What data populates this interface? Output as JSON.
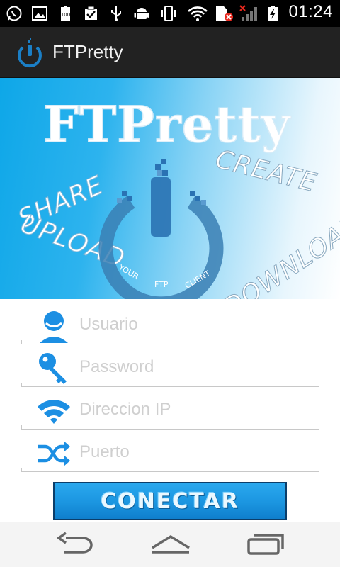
{
  "status_bar": {
    "time": "01:24",
    "icons": [
      "whatsapp-icon",
      "image-icon",
      "battery-100-icon",
      "task-icon",
      "usb-icon",
      "android-icon",
      "phone-vibrate-icon",
      "wifi-icon",
      "sim-error-icon",
      "signal-off-icon",
      "battery-charging-icon"
    ],
    "battery_badge": "100"
  },
  "action_bar": {
    "title": "FTPretty"
  },
  "banner": {
    "logo_title": "FTPretty",
    "word_share": "SHARE",
    "word_upload": "UPLOAD",
    "word_create": "CREATE",
    "word_download": "DOWNLOAD",
    "ring_word_1": "YOUR",
    "ring_word_2": "FTP",
    "ring_word_3": "CLIENT"
  },
  "form": {
    "usuario_placeholder": "Usuario",
    "password_placeholder": "Password",
    "ip_placeholder": "Direccion IP",
    "puerto_placeholder": "Puerto",
    "connect_label": "CONECTAR"
  },
  "colors": {
    "accent": "#1b95e0",
    "icon_blue": "#1c8fe3"
  }
}
